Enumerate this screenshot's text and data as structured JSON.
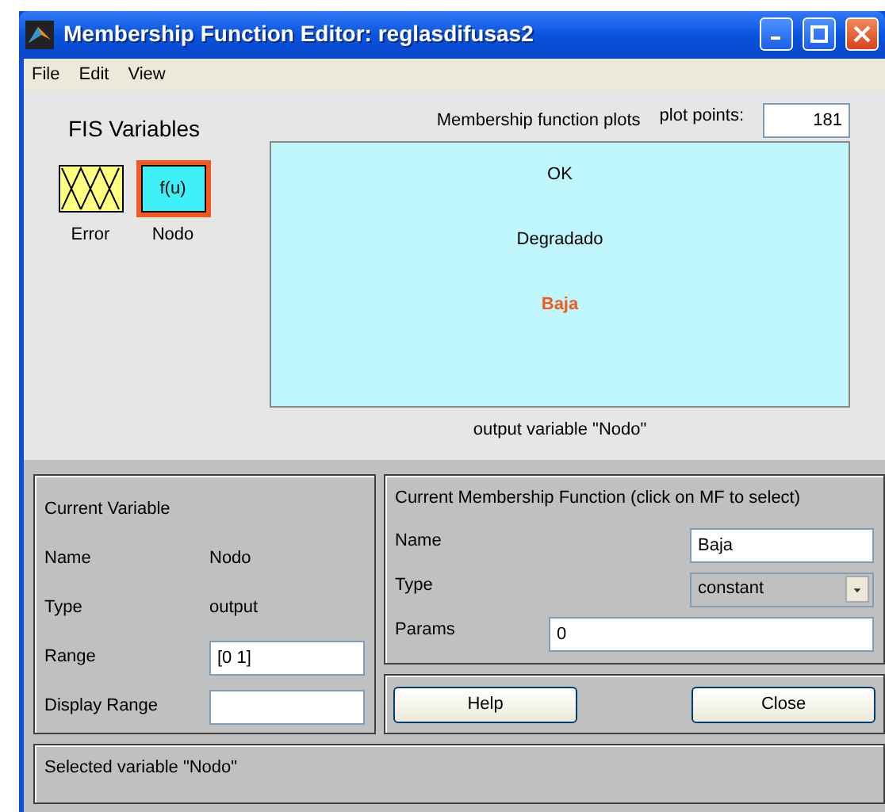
{
  "window": {
    "title": "Membership Function Editor: reglasdifusas2"
  },
  "menu": [
    {
      "label": "File"
    },
    {
      "label": "Edit"
    },
    {
      "label": "View"
    }
  ],
  "fis_variables": {
    "title": "FIS Variables",
    "items": [
      {
        "name": "Error",
        "kind": "input",
        "selected": false
      },
      {
        "name": "Nodo",
        "kind": "output",
        "label": "f(u)",
        "selected": true
      }
    ]
  },
  "plot": {
    "title": "Membership function plots",
    "plot_points_label": "plot points:",
    "plot_points": "181",
    "caption": "output variable \"Nodo\"",
    "functions": [
      {
        "name": "OK",
        "selected": false
      },
      {
        "name": "Degradado",
        "selected": false
      },
      {
        "name": "Baja",
        "selected": true
      }
    ]
  },
  "current_variable": {
    "title": "Current Variable",
    "name_label": "Name",
    "name": "Nodo",
    "type_label": "Type",
    "type": "output",
    "range_label": "Range",
    "range": "[0 1]",
    "display_range_label": "Display Range"
  },
  "current_mf": {
    "title": "Current Membership Function (click on MF to select)",
    "name_label": "Name",
    "name": "Baja",
    "type_label": "Type",
    "type": "constant",
    "params_label": "Params",
    "params": "0"
  },
  "buttons": [
    {
      "label": "Help"
    },
    {
      "label": "Close"
    }
  ],
  "status": "Selected variable \"Nodo\""
}
